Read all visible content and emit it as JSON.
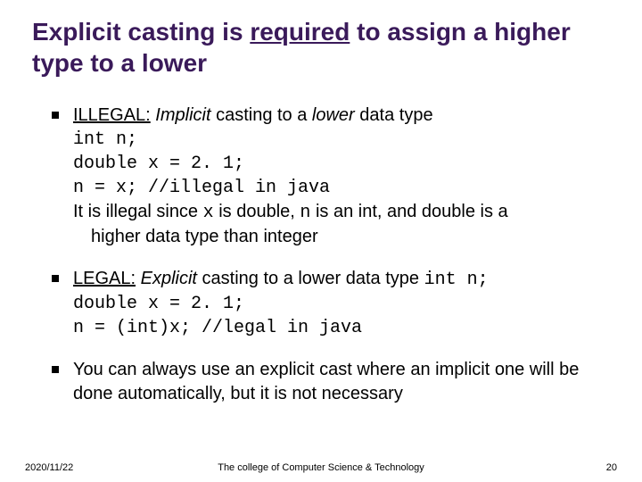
{
  "title": {
    "pre": "Explicit casting is ",
    "underlined": "required",
    "post": " to assign a higher type to a lower"
  },
  "bullets": [
    {
      "lead_ul": "ILLEGAL:",
      "lead_after": " ",
      "lead_em": "Implicit",
      "lead_rest": " casting to a ",
      "lead_em2": "lower",
      "lead_tail": " data type",
      "code": [
        "int n;",
        "double x = 2. 1;",
        "n = x; //illegal in java"
      ],
      "explain_pre": "It is illegal since ",
      "explain_x": "x",
      "explain_mid1": " is double, ",
      "explain_n": "n",
      "explain_mid2": " is an int, and double is a",
      "explain_wrap": "higher data type than integer"
    },
    {
      "lead_ul": "LEGAL:",
      "lead_after": " ",
      "lead_em": "Explicit",
      "lead_rest": " casting to a lower data type ",
      "lead_code_tail": "int n;",
      "code": [
        "double x = 2. 1;",
        "n = (int)x; //legal in java"
      ]
    },
    {
      "plain": "You can always use an explicit cast where an implicit one will be done automatically, but it is not necessary"
    }
  ],
  "footer": {
    "left": "2020/11/22",
    "center": "The college of Computer Science & Technology",
    "right": "20"
  }
}
